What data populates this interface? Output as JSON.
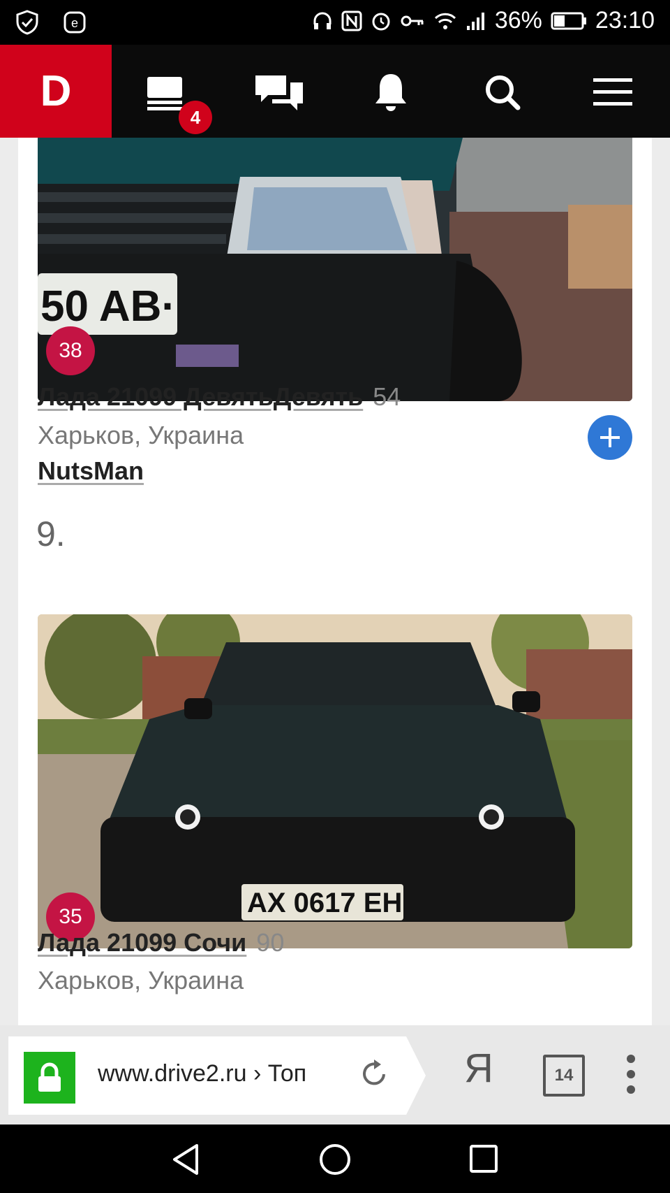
{
  "status_bar": {
    "battery": "36%",
    "time": "23:10"
  },
  "app_header": {
    "logo": "D",
    "feed_badge": "4"
  },
  "cars": [
    {
      "count": "38",
      "title": "Лада 21099 ДевятьДевять",
      "number": "54",
      "city": "Харьков, Украина",
      "user": "NutsMan"
    },
    {
      "rank": "9.",
      "count": "35",
      "title": "Лада 21099 Сочи",
      "number": "90",
      "city": "Харьков, Украина"
    }
  ],
  "browser": {
    "url": "www.drive2.ru › Топ",
    "yandex": "Я",
    "tab_count": "14"
  },
  "icons": [
    "shield-icon",
    "e-icon",
    "headphones-icon",
    "nfc-icon",
    "alarm-icon",
    "key-icon",
    "wifi-icon",
    "signal-icon",
    "battery-icon",
    "feed-icon",
    "messages-icon",
    "bell-icon",
    "search-icon",
    "menu-icon",
    "plus-icon",
    "lock-icon",
    "reload-icon",
    "more-icon",
    "back-icon",
    "home-icon",
    "recents-icon"
  ]
}
